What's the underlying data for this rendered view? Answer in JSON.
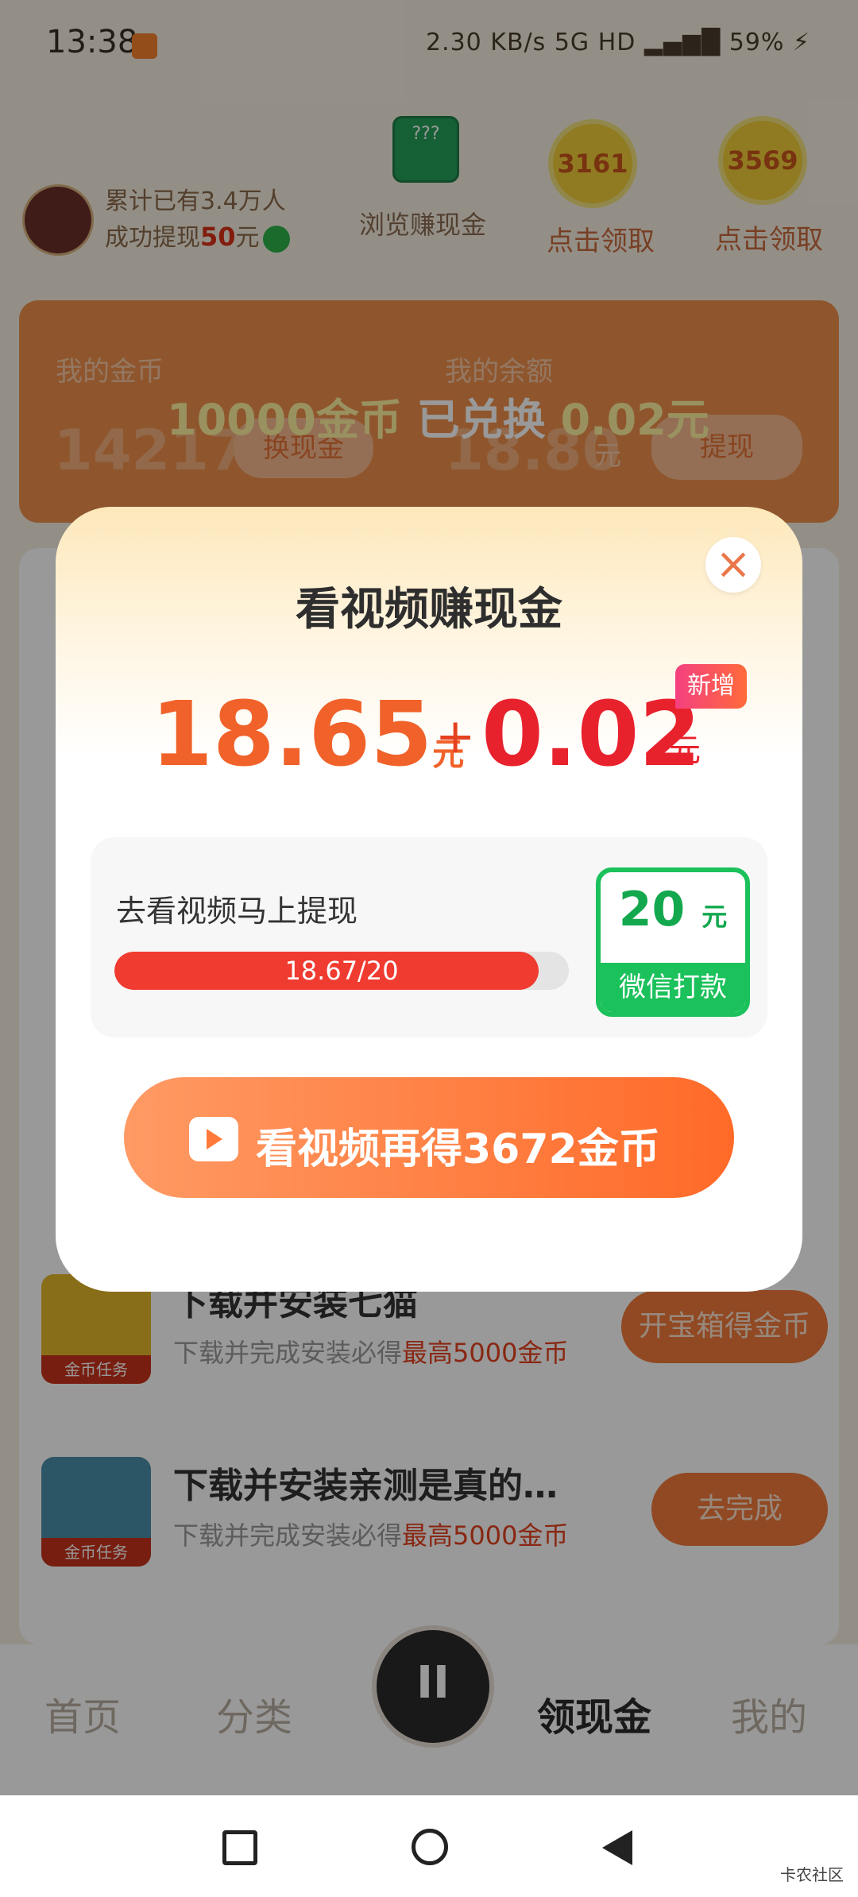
{
  "status_bar": {
    "time": "13:38",
    "right": "2.30 KB/s  5G HD  ▂▄▆█  59% ⚡"
  },
  "header": {
    "line1": "累计已有3.4万人",
    "line2_prefix": "成功提现",
    "line2_amount": "50",
    "line2_suffix": "元",
    "bonus_icon_text": "???",
    "bonus_label": "浏览赚现金",
    "coin1": "3161",
    "coin1_label": "点击领取",
    "coin2": "3569",
    "coin2_label": "点击领取"
  },
  "card": {
    "coins_label": "我的金币",
    "coins_value": "14217",
    "exchange_btn": "换现金",
    "balance_label": "我的余额",
    "balance_value": "18.80",
    "balance_unit": "元",
    "withdraw_btn": "提现",
    "banner_prefix": "10000金币",
    "banner_mid": " 已兑换 ",
    "banner_amount": "0.02元"
  },
  "tasks": [
    {
      "title": "下载并安装七猫",
      "sub_prefix": "下载并完成安装必得",
      "sub_highlight": "最高5000金币",
      "tag": "金币任务",
      "button": "开宝箱得金币"
    },
    {
      "title": "下载并安装亲测是真的…",
      "sub_prefix": "下载并完成安装必得",
      "sub_highlight": "最高5000金币",
      "tag": "金币任务",
      "button": "去完成"
    }
  ],
  "nav": {
    "home": "首页",
    "category": "分类",
    "center": "II",
    "cash": "领现金",
    "mine": "我的"
  },
  "watermark": "卡农社区",
  "modal": {
    "title": "看视频赚现金",
    "amount_current": "18.65",
    "unit": "元",
    "plus": "+",
    "amount_added": "0.02",
    "new_badge": "新增",
    "progress_label": "去看视频马上提现",
    "progress_text": "18.67/20",
    "progress_value": 18.67,
    "progress_max": 20,
    "reward_amount": "20",
    "reward_unit": "元",
    "reward_footer": "微信打款",
    "cta": "看视频再得3672金币",
    "close": "×"
  },
  "colors": {
    "accent": "#f0622a",
    "red": "#e8222d",
    "wechat_green": "#1bc15b"
  }
}
